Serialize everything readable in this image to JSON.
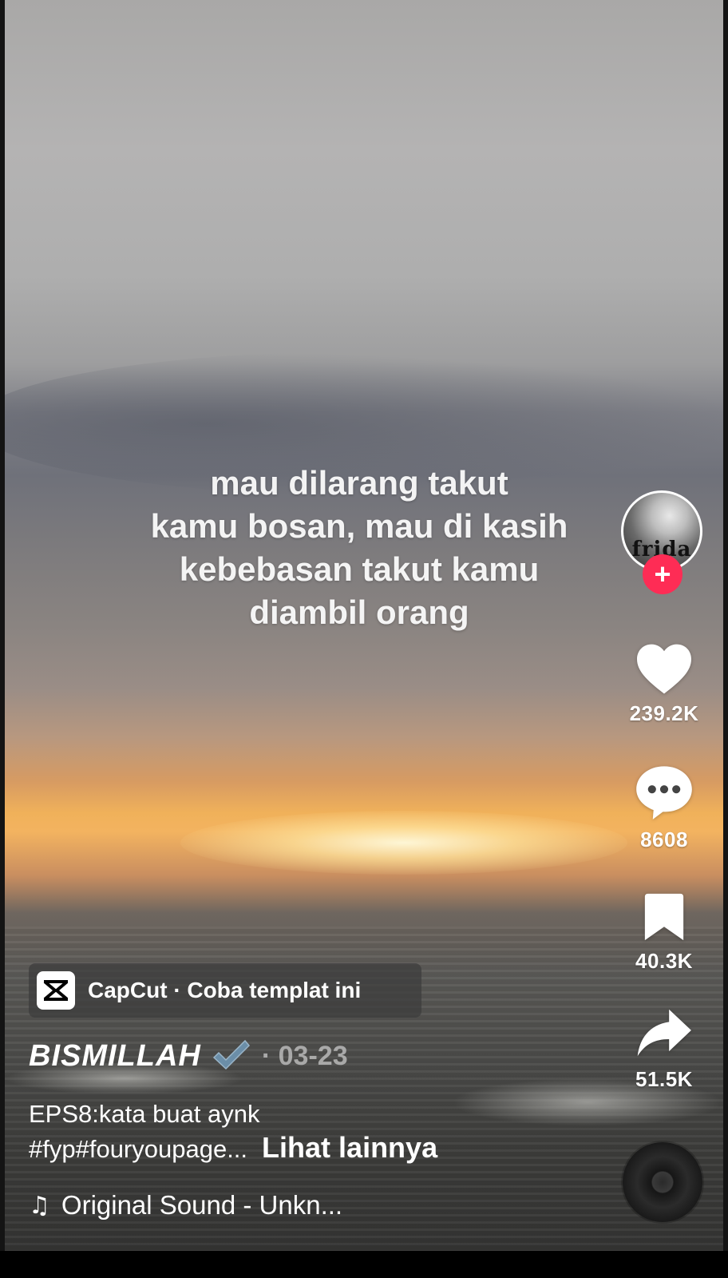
{
  "overlay_text": [
    "mau dilarang takut",
    "kamu bosan, mau di kasih",
    "kebebasan takut kamu",
    "diambil orang"
  ],
  "creator": {
    "avatar_text": "frida",
    "follow_symbol": "+"
  },
  "actions": {
    "likes": "239.2K",
    "comments": "8608",
    "saves": "40.3K",
    "shares": "51.5K"
  },
  "capcut": {
    "label": "CapCut · Coba templat ini",
    "icon": "capcut-logo"
  },
  "post": {
    "author": "BISMILLAH",
    "verified_icon": "check-mark",
    "date": "· 03-23",
    "caption_line1": "EPS8:kata buat aynk",
    "caption_line2": "#fyp#fouryoupage...",
    "see_more": "Lihat lainnya"
  },
  "sound": {
    "note": "♫",
    "title": "Original Sound - Unkn..."
  },
  "colors": {
    "follow": "#fe2c55",
    "chip": "#3c3c3c"
  }
}
